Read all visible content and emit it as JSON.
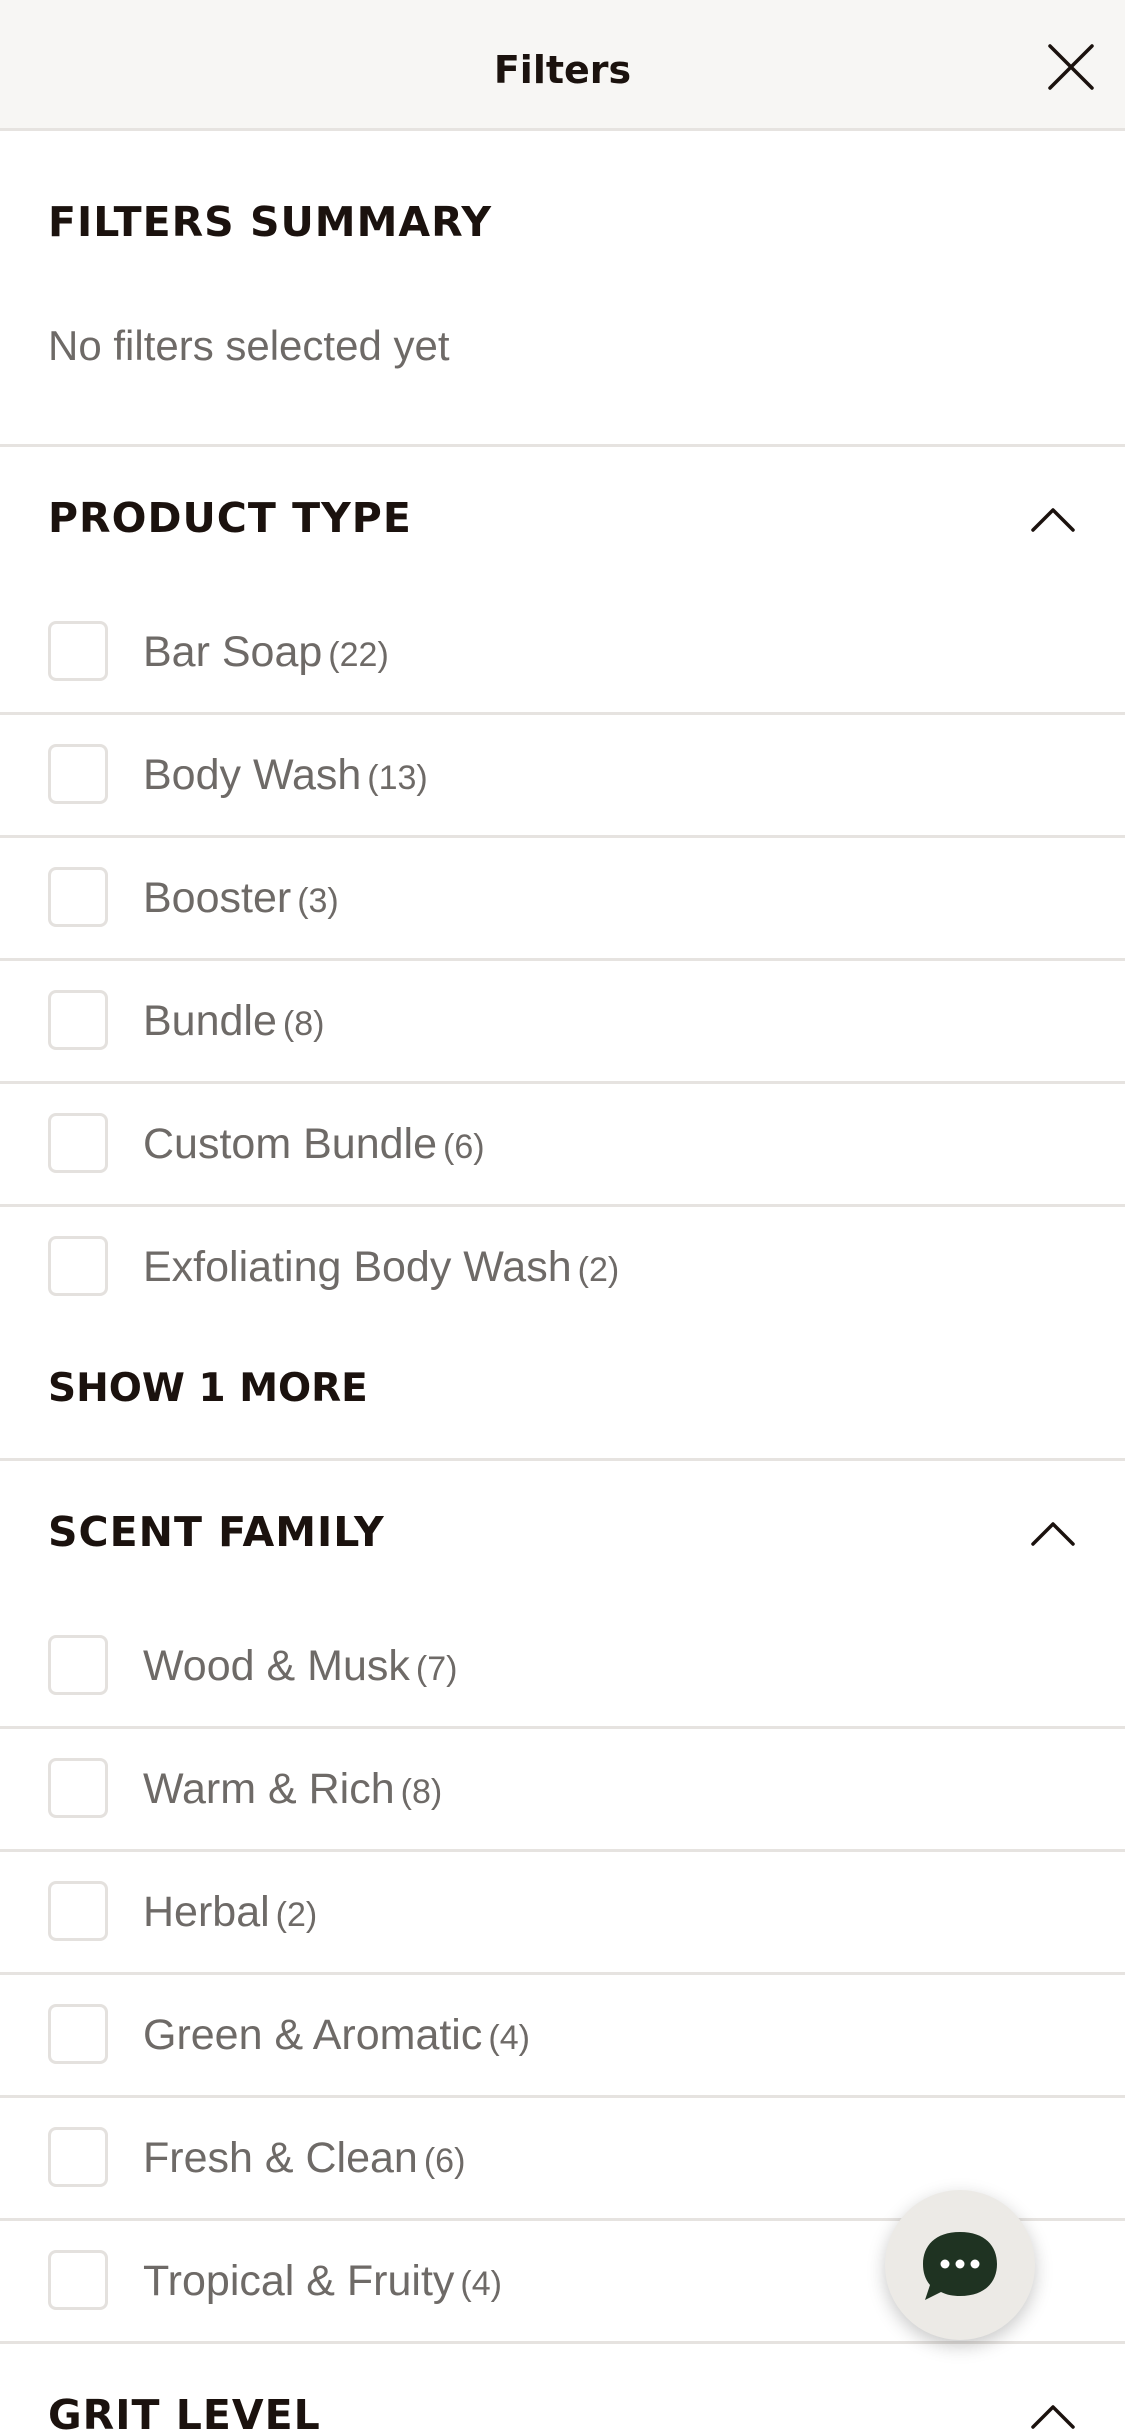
{
  "header": {
    "title": "Filters"
  },
  "summary": {
    "title": "FILTERS SUMMARY",
    "empty_text": "No filters selected yet"
  },
  "product_type": {
    "title": "PRODUCT TYPE",
    "items": [
      {
        "label": "Bar Soap",
        "count": "(22)"
      },
      {
        "label": "Body Wash",
        "count": "(13)"
      },
      {
        "label": "Booster",
        "count": "(3)"
      },
      {
        "label": "Bundle",
        "count": "(8)"
      },
      {
        "label": "Custom Bundle",
        "count": "(6)"
      },
      {
        "label": "Exfoliating Body Wash",
        "count": "(2)"
      }
    ],
    "show_more": "SHOW 1 MORE"
  },
  "scent_family": {
    "title": "SCENT FAMILY",
    "items": [
      {
        "label": "Wood & Musk",
        "count": "(7)"
      },
      {
        "label": "Warm & Rich",
        "count": "(8)"
      },
      {
        "label": "Herbal",
        "count": "(2)"
      },
      {
        "label": "Green & Aromatic",
        "count": "(4)"
      },
      {
        "label": "Fresh & Clean",
        "count": "(6)"
      },
      {
        "label": "Tropical & Fruity",
        "count": "(4)"
      }
    ]
  },
  "grit_level": {
    "title": "GRIT LEVEL"
  },
  "icons": {
    "close": "close-icon",
    "chevron": "chevron-up-icon",
    "chat": "chat-bubble-icon"
  },
  "colors": {
    "text_dark": "#1b120e",
    "text_muted": "#6e6a67",
    "divider": "#e6e3e0",
    "chat_bubble": "#1f3322"
  }
}
